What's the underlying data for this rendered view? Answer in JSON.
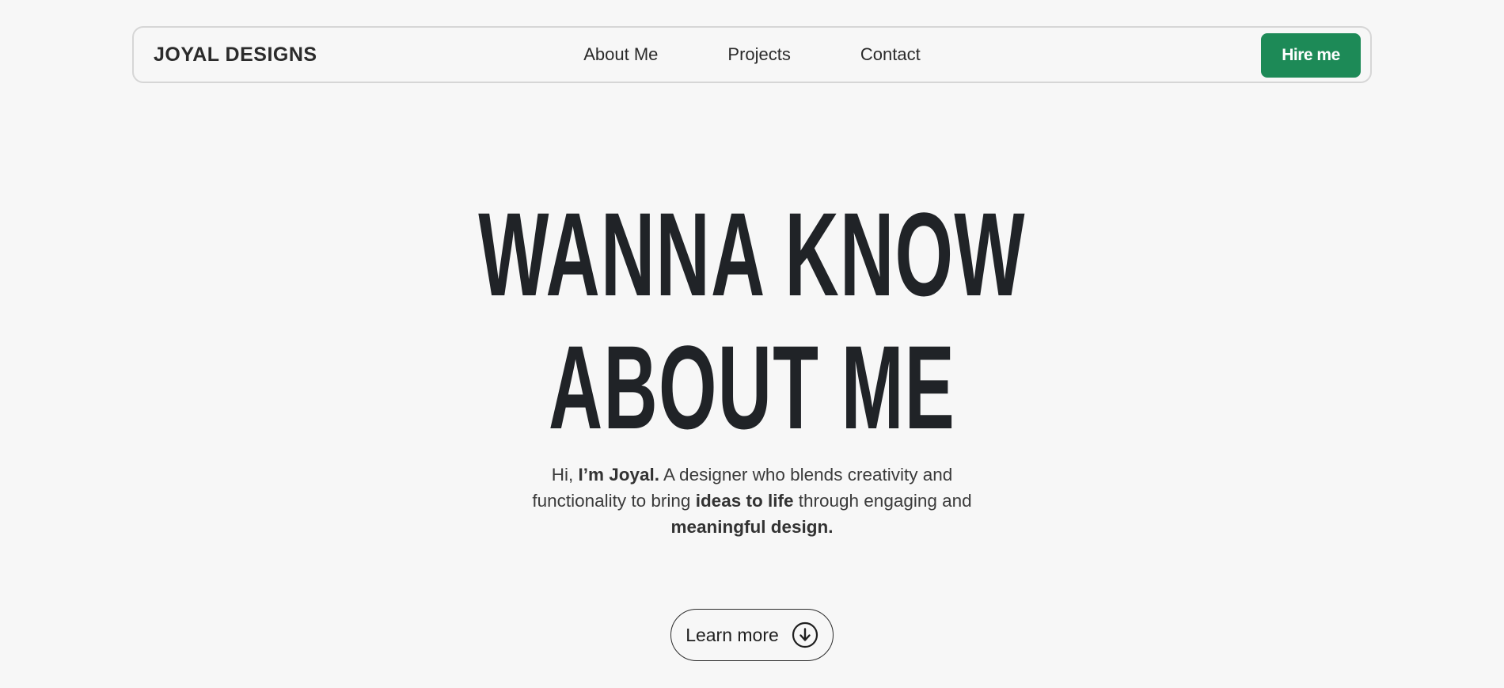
{
  "header": {
    "brand": "JOYAL DESIGNS",
    "nav": [
      {
        "label": "About Me"
      },
      {
        "label": "Projects"
      },
      {
        "label": "Contact"
      }
    ],
    "cta_label": "Hire me"
  },
  "hero": {
    "title_line_1": "WANNA KNOW",
    "title_line_2": "ABOUT ME",
    "desc": {
      "p1": "Hi, ",
      "b1": "I’m Joyal.",
      "p2": " A designer who blends creativity and functionality to bring ",
      "b2": "ideas to life",
      "p3": " through engaging and ",
      "b3": "meaningful design."
    },
    "button_label": "Learn more",
    "button_icon": "arrow-down-circle-icon"
  },
  "colors": {
    "accent": "#1d8a57",
    "background": "#f7f7f7",
    "title": "#202327"
  }
}
